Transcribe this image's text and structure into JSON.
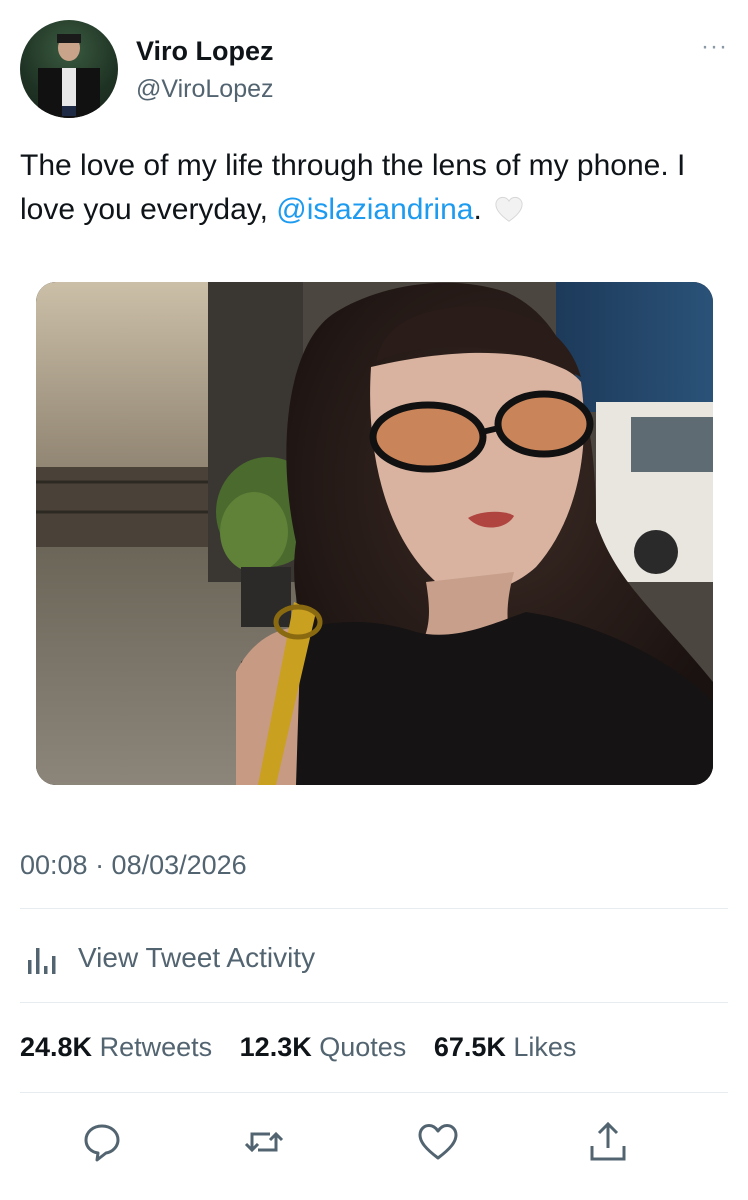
{
  "author": {
    "name": "Viro Lopez",
    "handle": "@ViroLopez"
  },
  "more_label": "···",
  "tweet": {
    "text_before": "The love of my life through the lens of my phone. I love you everyday, ",
    "mention": "@islaziandrina",
    "text_after": ".",
    "emoji": "white-heart-icon"
  },
  "timestamp": "00:08 · 08/03/2026",
  "activity_label": "View Tweet Activity",
  "stats": [
    {
      "value": "24.8K",
      "label": "Retweets"
    },
    {
      "value": "12.3K",
      "label": "Quotes"
    },
    {
      "value": "67.5K",
      "label": "Likes"
    }
  ],
  "actions": [
    "reply-icon",
    "retweet-icon",
    "like-icon",
    "share-icon"
  ],
  "colors": {
    "link": "#1d9bf0",
    "secondary_text": "#536471",
    "divider": "#e6ecf0"
  }
}
